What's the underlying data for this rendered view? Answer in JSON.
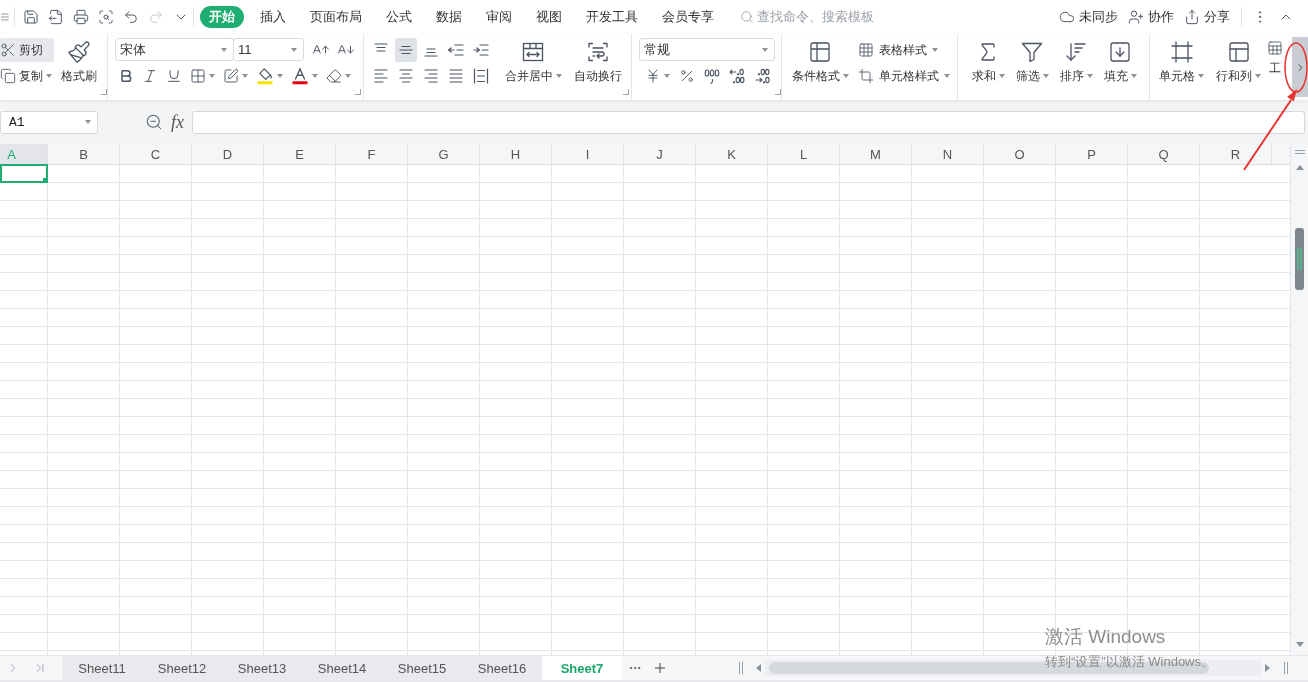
{
  "quick_access": [
    {
      "kind": "menu",
      "disabled": false
    },
    {
      "kind": "save",
      "disabled": false
    },
    {
      "kind": "export",
      "disabled": false
    },
    {
      "kind": "print",
      "disabled": false
    },
    {
      "kind": "preview",
      "disabled": false
    },
    {
      "kind": "undo",
      "disabled": false
    },
    {
      "kind": "redo",
      "disabled": true
    },
    {
      "kind": "more",
      "disabled": false
    }
  ],
  "tabs": [
    {
      "label": "开始",
      "selected": true
    },
    {
      "label": "插入",
      "selected": false
    },
    {
      "label": "页面布局",
      "selected": false
    },
    {
      "label": "公式",
      "selected": false
    },
    {
      "label": "数据",
      "selected": false
    },
    {
      "label": "审阅",
      "selected": false
    },
    {
      "label": "视图",
      "selected": false
    },
    {
      "label": "开发工具",
      "selected": false
    },
    {
      "label": "会员专享",
      "selected": false
    }
  ],
  "search": {
    "placeholder": "查找命令、搜索模板"
  },
  "actions": [
    {
      "kind": "sync",
      "label": "未同步"
    },
    {
      "kind": "collab",
      "label": "协作"
    },
    {
      "kind": "share",
      "label": "分享"
    }
  ],
  "window_controls": [
    {
      "kind": "more"
    },
    {
      "kind": "collapse"
    }
  ],
  "clipboard": {
    "small": [
      {
        "kind": "cut",
        "label": "剪切",
        "highlighted": true,
        "dropdown": false
      },
      {
        "kind": "copy",
        "label": "复制",
        "highlighted": false,
        "dropdown": true
      }
    ],
    "painter": {
      "label": "格式刷"
    }
  },
  "font": {
    "name": "宋体",
    "size": "11",
    "size_buttons": [
      {
        "kind": "grow"
      },
      {
        "kind": "shrink"
      }
    ],
    "tools": [
      {
        "kind": "bold",
        "dropdown": false
      },
      {
        "kind": "italic",
        "dropdown": false
      },
      {
        "kind": "underline",
        "dropdown": false
      },
      {
        "kind": "borders",
        "dropdown": true
      },
      {
        "kind": "cell_style",
        "dropdown": true
      },
      {
        "kind": "fill",
        "dropdown": true
      },
      {
        "kind": "font_color",
        "dropdown": true
      },
      {
        "kind": "clear",
        "dropdown": true
      }
    ]
  },
  "alignment": {
    "tools": [
      {
        "kind": "top",
        "selected": false
      },
      {
        "kind": "middle",
        "selected": true
      },
      {
        "kind": "bottom",
        "selected": false
      },
      {
        "kind": "indent_less",
        "selected": false
      },
      {
        "kind": "indent_more",
        "selected": false
      },
      {
        "kind": "left",
        "selected": false
      },
      {
        "kind": "center",
        "selected": false
      },
      {
        "kind": "right",
        "selected": false
      },
      {
        "kind": "justify",
        "selected": false
      },
      {
        "kind": "distributed",
        "selected": false
      }
    ],
    "buttons": [
      {
        "kind": "merge",
        "label": "合并居中",
        "dropdown": true
      },
      {
        "kind": "wrap",
        "label": "自动换行",
        "dropdown": false
      }
    ]
  },
  "number": {
    "format": "常规",
    "tools": [
      {
        "kind": "currency",
        "dropdown": true
      },
      {
        "kind": "percent",
        "dropdown": false
      },
      {
        "kind": "thousands",
        "dropdown": false
      },
      {
        "kind": "decimal_more",
        "dropdown": false
      },
      {
        "kind": "decimal_less",
        "dropdown": false
      }
    ]
  },
  "styles": {
    "conditional": {
      "label": "条件格式",
      "dropdown": true
    },
    "small": [
      {
        "kind": "table_style",
        "label": "表格样式",
        "dropdown": true
      },
      {
        "kind": "cell_style",
        "label": "单元格样式",
        "dropdown": true
      }
    ]
  },
  "editing": [
    {
      "kind": "sum",
      "label": "求和",
      "dropdown": true
    },
    {
      "kind": "filter",
      "label": "筛选",
      "dropdown": true
    },
    {
      "kind": "sort",
      "label": "排序",
      "dropdown": true
    },
    {
      "kind": "fill",
      "label": "填充",
      "dropdown": true
    }
  ],
  "cells": [
    {
      "kind": "cell",
      "label": "单元格",
      "dropdown": true
    },
    {
      "kind": "rowcol",
      "label": "行和列",
      "dropdown": true
    },
    {
      "kind": "sheet",
      "label": "工",
      "dropdown": false
    }
  ],
  "formula_bar": {
    "name_box": "A1",
    "function_label": "fx"
  },
  "columns": [
    {
      "label": "A",
      "selected": true
    },
    {
      "label": "B",
      "selected": false
    },
    {
      "label": "C",
      "selected": false
    },
    {
      "label": "D",
      "selected": false
    },
    {
      "label": "E",
      "selected": false
    },
    {
      "label": "F",
      "selected": false
    },
    {
      "label": "G",
      "selected": false
    },
    {
      "label": "H",
      "selected": false
    },
    {
      "label": "I",
      "selected": false
    },
    {
      "label": "J",
      "selected": false
    },
    {
      "label": "K",
      "selected": false
    },
    {
      "label": "L",
      "selected": false
    },
    {
      "label": "M",
      "selected": false
    },
    {
      "label": "N",
      "selected": false
    },
    {
      "label": "O",
      "selected": false
    },
    {
      "label": "P",
      "selected": false
    },
    {
      "label": "Q",
      "selected": false
    },
    {
      "label": "R",
      "selected": false
    }
  ],
  "sheet_tabs": [
    {
      "label": "Sheet11",
      "selected": false
    },
    {
      "label": "Sheet12",
      "selected": false
    },
    {
      "label": "Sheet13",
      "selected": false
    },
    {
      "label": "Sheet14",
      "selected": false
    },
    {
      "label": "Sheet15",
      "selected": false
    },
    {
      "label": "Sheet16",
      "selected": false
    },
    {
      "label": "Sheet7",
      "selected": true
    }
  ],
  "os_notice": {
    "title": "激活 Windows",
    "subtitle": "转到“设置”以激活 Windows。"
  }
}
